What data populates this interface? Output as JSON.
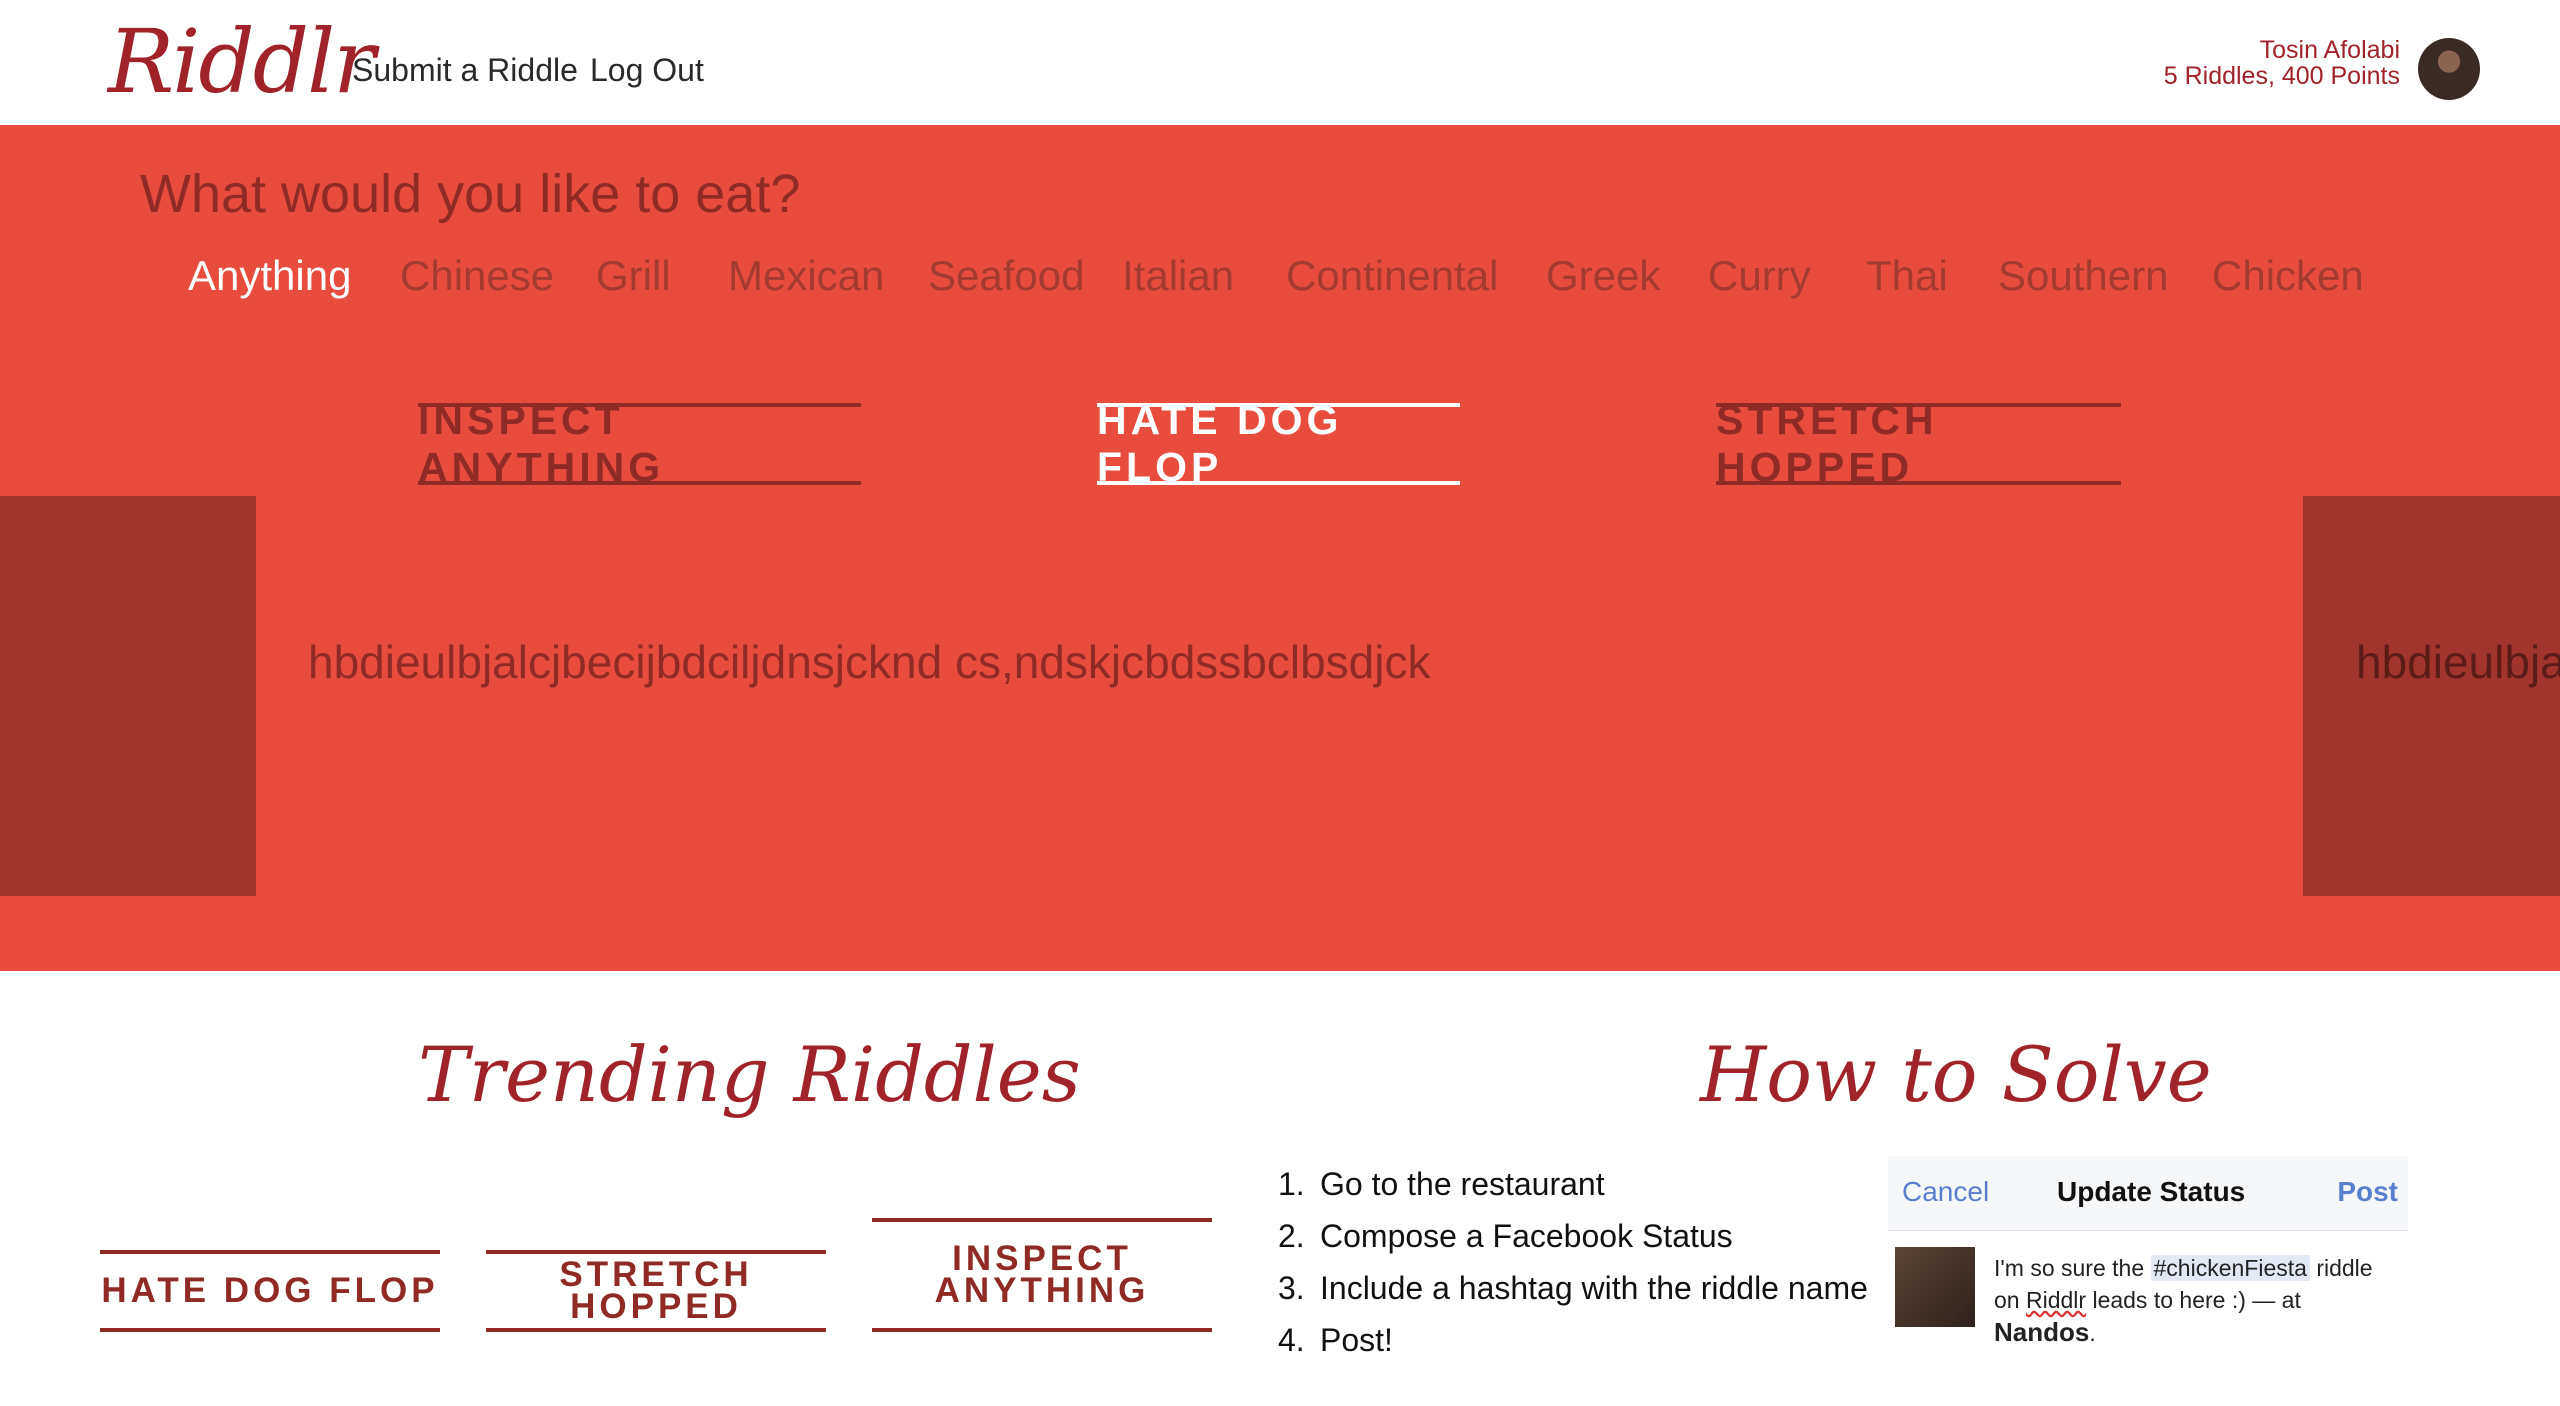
{
  "header": {
    "logo": "Riddlr",
    "nav": [
      "Submit a Riddle",
      "Log Out"
    ],
    "user": {
      "name": "Tosin Afolabi",
      "stats": "5 Riddles, 400 Points"
    }
  },
  "hero": {
    "question": "What would you like to eat?",
    "categories": [
      "Anything",
      "Chinese",
      "Grill",
      "Mexican",
      "Seafood",
      "Italian",
      "Continental",
      "Greek",
      "Curry",
      "Thai",
      "Southern",
      "Chicken"
    ],
    "riddle_tabs": [
      "INSPECT ANYTHING",
      "HATE DOG FLOP",
      "STRETCH HOPPED"
    ],
    "riddle_text": "hbdieulbjalcjbecijbdciljdnsjcknd cs,ndskjcbdssbclbsdjck",
    "riddle_peek": "hbdieulbja"
  },
  "trending": {
    "title": "Trending Riddles",
    "cards": [
      "HATE DOG FLOP",
      "STRETCH HOPPED",
      "INSPECT ANYTHING"
    ]
  },
  "how_to": {
    "title": "How to Solve",
    "steps": [
      {
        "num": "1.",
        "text": "Go to the restaurant"
      },
      {
        "num": "2.",
        "text": "Compose a Facebook Status"
      },
      {
        "num": "3.",
        "text": "Include a hashtag with the riddle name"
      },
      {
        "num": "4.",
        "text": "Post!"
      }
    ]
  },
  "fb_status": {
    "cancel": "Cancel",
    "title": "Update Status",
    "post": "Post",
    "text_before": "I'm so sure the ",
    "hashtag": "#chickenFiesta",
    "text_after": " riddle on ",
    "brand": "Riddlr",
    "text_end": " leads to here :) — at",
    "place": "Nandos",
    "period": "."
  },
  "colors": {
    "brand_red": "#e74c3c",
    "dark_red": "#8f2a25",
    "logo_red": "#a0232a",
    "panel_red": "#a2352b",
    "fb_blue": "#5b7fcf"
  }
}
